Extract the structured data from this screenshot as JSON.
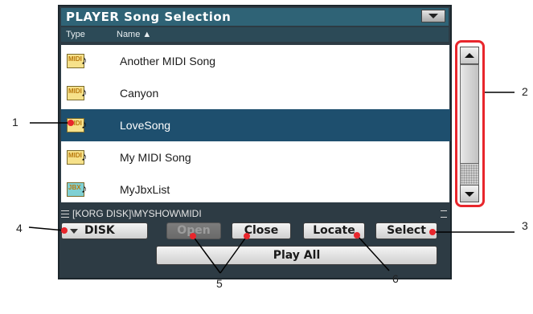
{
  "window": {
    "title": "PLAYER Song Selection"
  },
  "columns": {
    "type": "Type",
    "name": "Name ▲"
  },
  "files": [
    {
      "type_label": "MIDI",
      "type_color": "#f6e18a",
      "name": "Another MIDI Song",
      "selected": false
    },
    {
      "type_label": "MIDI",
      "type_color": "#f6e18a",
      "name": "Canyon",
      "selected": false
    },
    {
      "type_label": "MIDI",
      "type_color": "#f6e18a",
      "name": "LoveSong",
      "selected": true
    },
    {
      "type_label": "MIDI",
      "type_color": "#f6e18a",
      "name": "My MIDI Song",
      "selected": false
    },
    {
      "type_label": "JBX",
      "type_color": "#7fd0d4",
      "name": "MyJbxList",
      "selected": false
    }
  ],
  "path": "[KORG DISK]\\MYSHOW\\MIDI",
  "buttons": {
    "disk": "DISK",
    "open": "Open",
    "close": "Close",
    "locate": "Locate",
    "select": "Select",
    "play_all": "Play All"
  },
  "callouts": [
    "1",
    "2",
    "3",
    "4",
    "5",
    "6"
  ],
  "colors": {
    "highlight": "#1e4f6e",
    "callout_outline": "#e8262c",
    "screen_bg": "#2d3b44"
  }
}
